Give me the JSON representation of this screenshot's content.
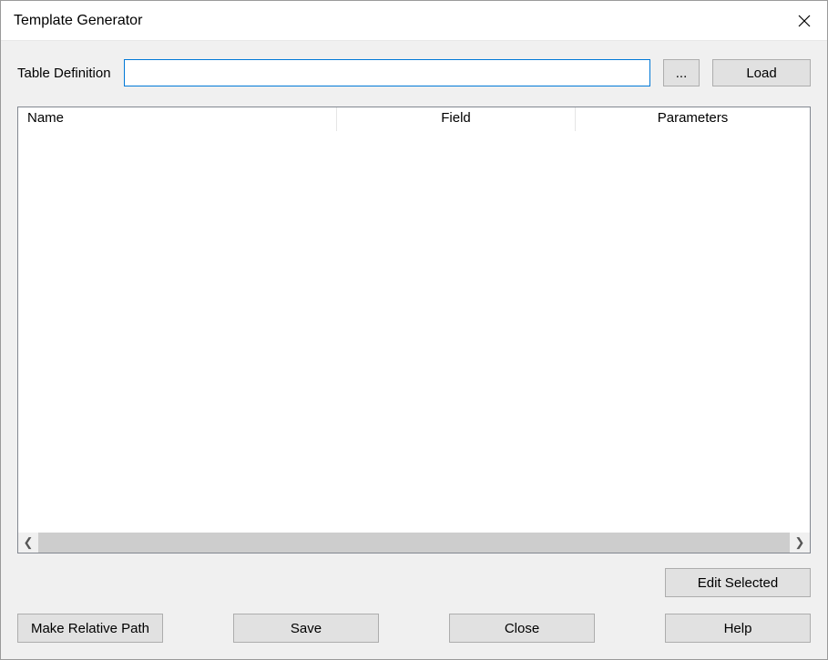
{
  "window": {
    "title": "Template Generator"
  },
  "definition": {
    "label": "Table Definition",
    "value": "",
    "browse_label": "...",
    "load_label": "Load"
  },
  "grid": {
    "columns": [
      "Name",
      "Field",
      "Parameters"
    ],
    "rows": []
  },
  "buttons": {
    "edit_selected": "Edit Selected",
    "make_relative": "Make Relative Path",
    "save": "Save",
    "close": "Close",
    "help": "Help"
  }
}
